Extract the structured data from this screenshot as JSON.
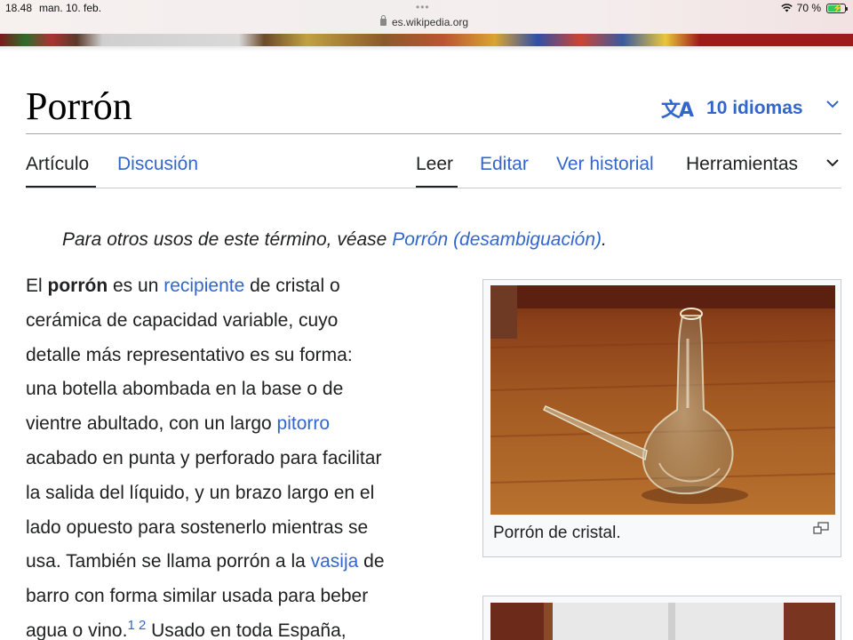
{
  "status_bar": {
    "time": "18.48",
    "date": "man. 10. feb.",
    "url": "es.wikipedia.org",
    "battery": "70 %",
    "wifi_icon": "wifi-icon",
    "battery_icon": "battery-charging-icon"
  },
  "article": {
    "title": "Porrón",
    "languages_label": "10 idiomas",
    "language_icon": "translate-icon"
  },
  "tabs": {
    "left": [
      {
        "label": "Artículo",
        "active": true
      },
      {
        "label": "Discusión",
        "active": false
      }
    ],
    "right": [
      {
        "label": "Leer",
        "active": true
      },
      {
        "label": "Editar",
        "active": false
      },
      {
        "label": "Ver historial",
        "active": false
      },
      {
        "label": "Herramientas",
        "active": false
      }
    ]
  },
  "hatnote": {
    "prefix": "Para otros usos de este término, véase ",
    "link": "Porrón (desambiguación)",
    "suffix": "."
  },
  "body": {
    "l1_a": "El ",
    "l1_bold": "porrón",
    "l1_b": " es un ",
    "l1_link": "recipiente",
    "l1_c": " de cristal o",
    "l2": "cerámica de capacidad variable, cuyo",
    "l3": "detalle más representativo es su forma:",
    "l4": "una botella abombada en la base o de",
    "l5_a": "vientre abultado, con un largo ",
    "l5_link": "pitorro",
    "l6": "acabado en punta y perforado para facilitar",
    "l7": "la salida del líquido, y un brazo largo en el",
    "l8": "lado opuesto para sostenerlo mientras se",
    "l9_a": "usa. También se llama porrón a la ",
    "l9_link": "vasija",
    "l9_b": " de",
    "l10": "barro con forma similar usada para beber",
    "l11_a": "agua o vino.",
    "ref1": "1",
    "ref2": "2",
    "l11_b": " Usado en toda España,"
  },
  "thumb": {
    "caption": "Porrón de cristal.",
    "enlarge_icon": "enlarge-icon"
  },
  "colors": {
    "link": "#3366cc",
    "text": "#202122",
    "rule": "#a2a9b1"
  }
}
